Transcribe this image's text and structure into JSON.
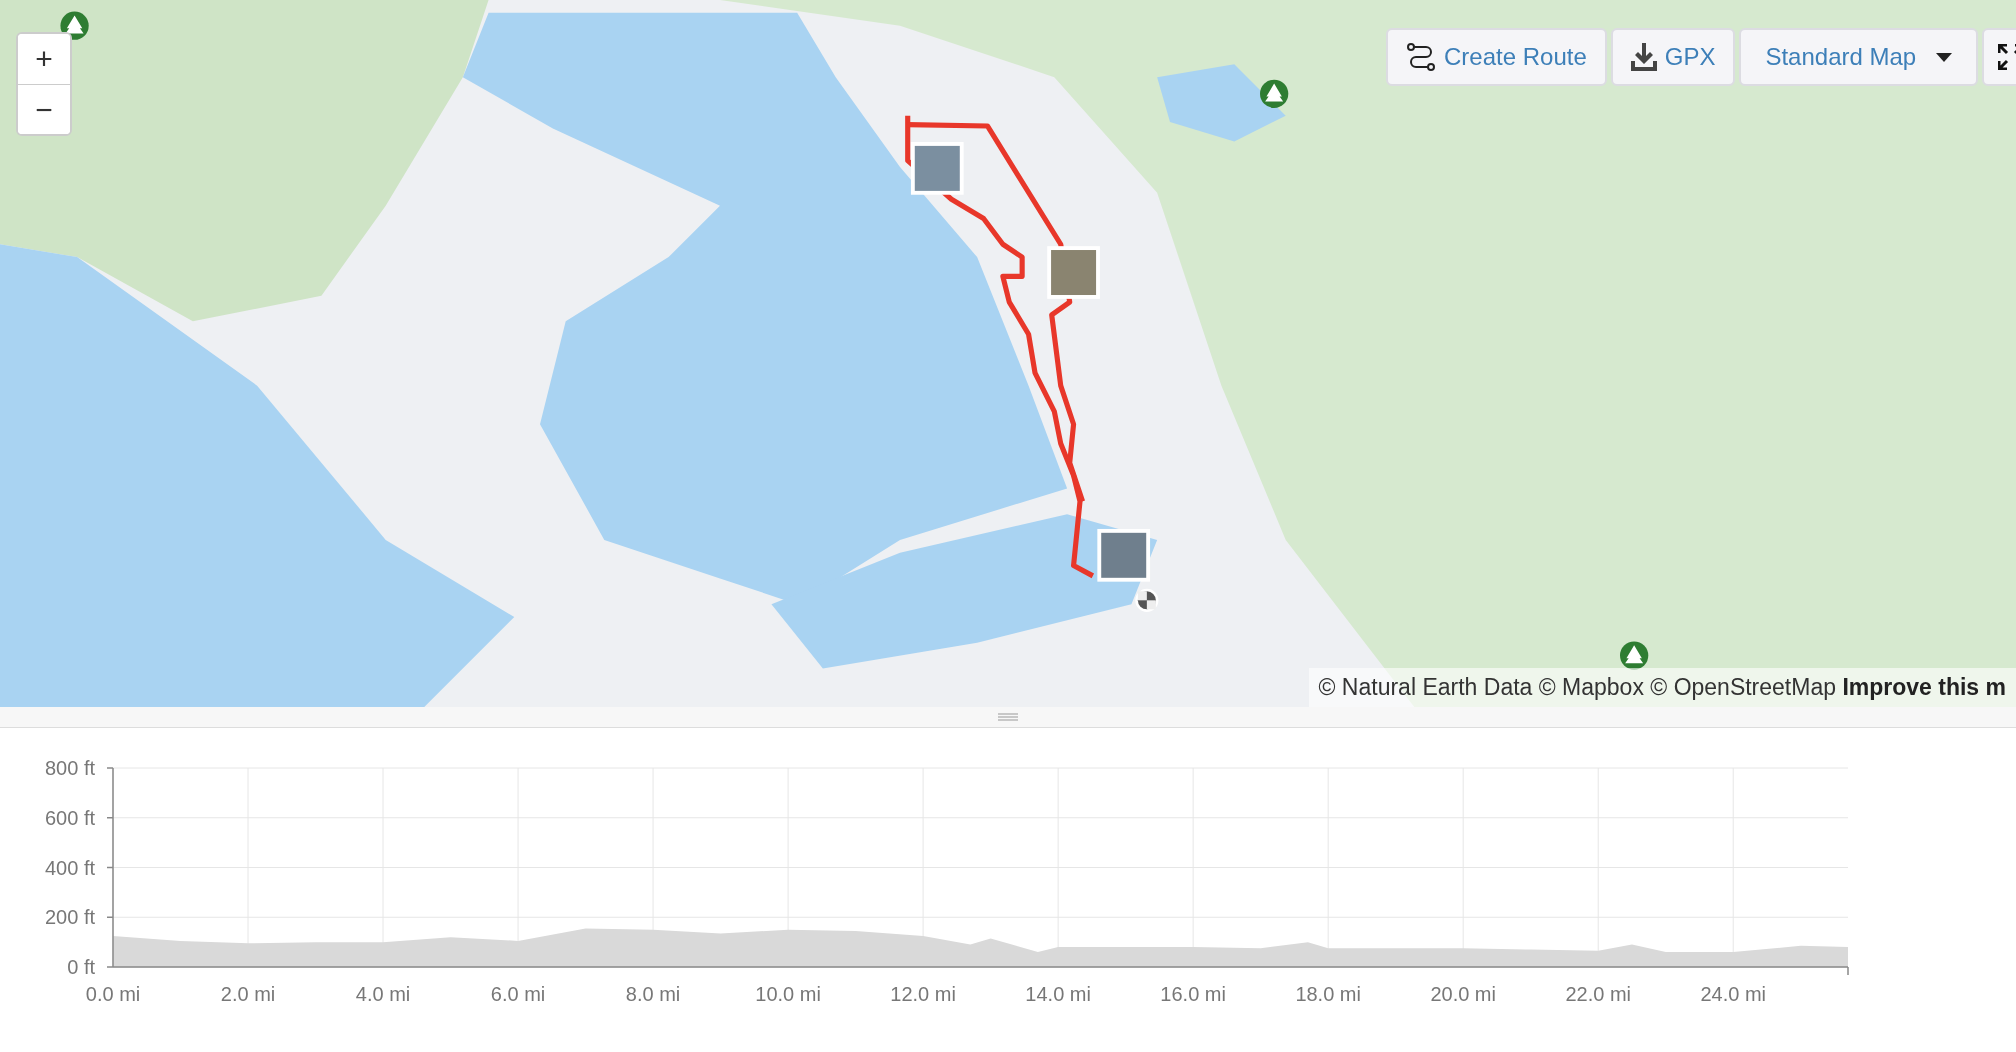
{
  "map": {
    "zoom_controls": [
      "+",
      "−"
    ],
    "toolbar": [
      {
        "kind": "route",
        "label": "Create Route"
      },
      {
        "kind": "download",
        "label": "GPX"
      },
      {
        "kind": "dropdown",
        "label": "Standard Map"
      },
      {
        "kind": "fullscreen"
      }
    ],
    "attribution": {
      "sources": "© Natural Earth Data © Mapbox © OpenStreetMap",
      "link": "Improve this m"
    }
  },
  "elevation": {
    "chart_data": {
      "type": "area",
      "grid": true,
      "x": [
        0,
        1,
        2,
        3,
        4,
        5,
        6,
        7,
        8,
        9,
        10,
        11,
        12,
        12.7,
        13,
        13.7,
        14,
        15,
        16,
        17,
        17.7,
        18,
        19,
        20,
        21,
        22,
        22.5,
        23,
        24,
        25,
        25.7
      ],
      "series": [
        {
          "color": "#d9d9d9",
          "values": [
            125,
            105,
            95,
            100,
            100,
            120,
            105,
            155,
            150,
            135,
            150,
            145,
            125,
            90,
            115,
            60,
            80,
            80,
            80,
            75,
            100,
            75,
            75,
            75,
            70,
            65,
            90,
            60,
            60,
            85,
            80
          ]
        }
      ],
      "xlim": [
        0,
        25.7
      ],
      "ylim": [
        0,
        800
      ],
      "xticks": [
        {
          "value": 0,
          "label": "0.0 mi"
        },
        {
          "value": 2,
          "label": "2.0 mi"
        },
        {
          "value": 4,
          "label": "4.0 mi"
        },
        {
          "value": 6,
          "label": "6.0 mi"
        },
        {
          "value": 8,
          "label": "8.0 mi"
        },
        {
          "value": 10,
          "label": "10.0 mi"
        },
        {
          "value": 12,
          "label": "12.0 mi"
        },
        {
          "value": 14,
          "label": "14.0 mi"
        },
        {
          "value": 16,
          "label": "16.0 mi"
        },
        {
          "value": 18,
          "label": "18.0 mi"
        },
        {
          "value": 20,
          "label": "20.0 mi"
        },
        {
          "value": 22,
          "label": "22.0 mi"
        },
        {
          "value": 24,
          "label": "24.0 mi"
        }
      ],
      "yticks": [
        {
          "value": 0,
          "label": "0 ft"
        },
        {
          "value": 200,
          "label": "200 ft"
        },
        {
          "value": 400,
          "label": "400 ft"
        },
        {
          "value": 600,
          "label": "600 ft"
        },
        {
          "value": 800,
          "label": "800 ft"
        }
      ]
    }
  }
}
